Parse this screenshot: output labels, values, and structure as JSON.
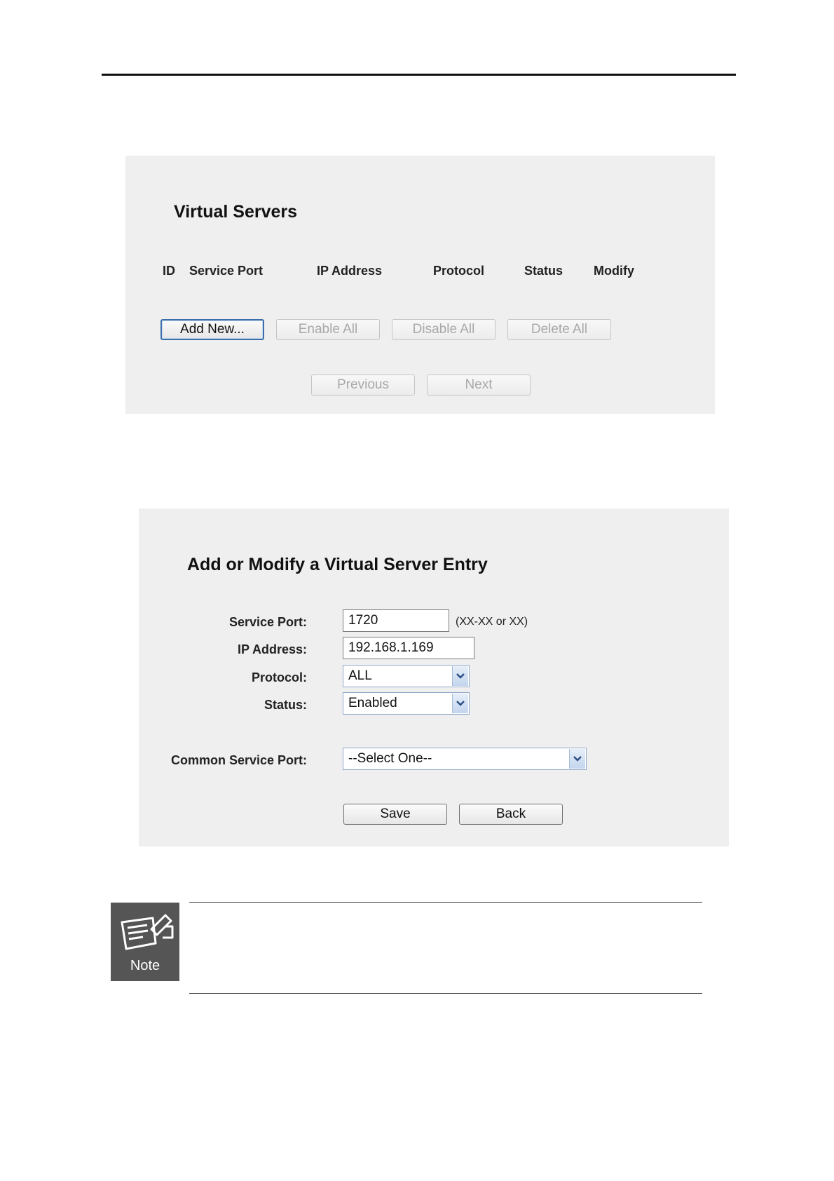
{
  "virtual_servers": {
    "title": "Virtual Servers",
    "columns": [
      "ID",
      "Service Port",
      "IP Address",
      "Protocol",
      "Status",
      "Modify"
    ],
    "buttons": {
      "add_new": "Add New...",
      "enable_all": "Enable All",
      "disable_all": "Disable All",
      "delete_all": "Delete All",
      "previous": "Previous",
      "next": "Next"
    }
  },
  "entry_form": {
    "title": "Add or Modify a Virtual Server Entry",
    "service_port": {
      "label": "Service Port:",
      "value": "1720",
      "hint": "(XX-XX or XX)"
    },
    "ip_address": {
      "label": "IP Address:",
      "value": "192.168.1.169"
    },
    "protocol": {
      "label": "Protocol:",
      "value": "ALL"
    },
    "status": {
      "label": "Status:",
      "value": "Enabled"
    },
    "common_service_port": {
      "label": "Common Service Port:",
      "value": "--Select One--"
    },
    "buttons": {
      "save": "Save",
      "back": "Back"
    }
  },
  "note": {
    "icon_label": "Note"
  }
}
